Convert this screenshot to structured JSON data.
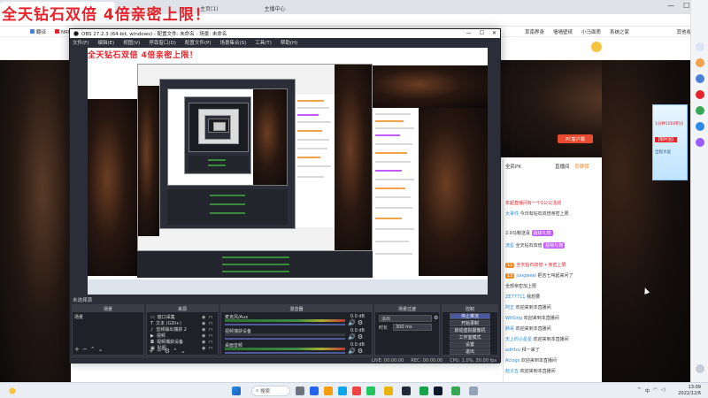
{
  "browser": {
    "tabs": [
      {
        "label": "全天钻石双倍 4倍亲密上限！",
        "active": true
      },
      {
        "label": "主页(1)",
        "active": false
      },
      {
        "label": "主题中心",
        "active": false
      },
      {
        "label": "主播中心",
        "active": false
      }
    ],
    "bookmarks": [
      "翻译",
      "NRU魔兽世界",
      "全天钻石双倍 4倍亲密上限！"
    ],
    "bookmarks_right": [
      "草南界身",
      "墙墙壁纸",
      "小马面质",
      "系统之家",
      "其他收藏夹"
    ],
    "promo": "全天钻石双倍 4倍亲密上限！"
  },
  "stream_page": {
    "pc_button": "PC客户端",
    "chat_tabs": [
      "全民PK",
      "直播间",
      "贡献榜"
    ],
    "chat_lines": [
      {
        "user": "",
        "text": "年起直播间有一个1公公活动",
        "badge": ""
      },
      {
        "user": "大事件",
        "text": "今日有钻石双倍亲密上限",
        "badge": ""
      },
      {
        "user": "",
        "text": "2.0马鞍送喜",
        "badge": "",
        "gift": "超级礼物"
      },
      {
        "user": "流星",
        "text": "全天钻石双倍",
        "badge": "",
        "gift": "超级礼物"
      },
      {
        "user": "",
        "text": "全天钻石双倍 • 亲密上限",
        "badge": "11"
      },
      {
        "user": "jungweel",
        "text": "把吉七叫起来问了",
        "badge": "13"
      },
      {
        "user": "",
        "text": "全部亲密加上限",
        "badge": ""
      },
      {
        "user": "ZE77711",
        "text": "我想要",
        "badge": ""
      },
      {
        "user": "阿正",
        "text": "欢迎来到本直播间",
        "badge": ""
      },
      {
        "user": "WitSing",
        "text": "欢迎来到本直播间",
        "badge": ""
      },
      {
        "user": "胖哥",
        "text": "欢迎来到本直播间",
        "badge": ""
      },
      {
        "user": "天上的小星星",
        "text": "欢迎来到本直播间",
        "badge": ""
      },
      {
        "user": "adhfzu",
        "text": "拜一来了",
        "badge": ""
      },
      {
        "user": "Aclogs",
        "text": "欢迎来到本直播间",
        "badge": ""
      },
      {
        "user": "赵子五",
        "text": "欢迎来到本直播间",
        "badge": ""
      }
    ],
    "side_ad": {
      "line1": "1分钟1000积分",
      "line2": "【限时送】",
      "line3": "全程大促"
    }
  },
  "obs": {
    "title": "OBS 27.2.3 (64-bit, windows) - 配置文件: 未命名 - 场景: 未命名",
    "menu": [
      "文件(F)",
      "编辑(E)",
      "视图(V)",
      "停靠窗口(D)",
      "配置文件(P)",
      "场景集合(S)",
      "工具(T)",
      "帮助(H)"
    ],
    "preview_promo": "全天钻石双倍 4倍亲密上限！",
    "docks": {
      "scene_label": "未选择源",
      "scenes_title": "场景",
      "scenes": [
        "场景"
      ],
      "sources_title": "来源",
      "sources": [
        "窗口采集",
        "文本 (GDI+)",
        "音频输出捕获 2",
        "视频",
        "视频捕获设备",
        "贴图"
      ],
      "mixer_title": "混音器",
      "mixer": [
        {
          "name": "麦克风/Aux",
          "db": "0.0 dB",
          "active": true
        },
        {
          "name": "视频捕获设备",
          "db": "0.0 dB",
          "active": false
        },
        {
          "name": "桌面音频",
          "db": "0.0 dB",
          "active": true
        }
      ],
      "transitions_title": "场景过渡",
      "transition": "淡出",
      "duration_label": "时长",
      "duration": "300 ms",
      "controls_title": "控制",
      "controls": [
        "停止推流",
        "开始录制",
        "启动虚拟摄像机",
        "工作室模式",
        "设置",
        "退出"
      ]
    },
    "status": [
      "LIVE: 00:00:00",
      "REC: 00:00:00",
      "CPU: 1.0%, 30.00 fps"
    ]
  },
  "taskbar": {
    "search": "搜索",
    "time": "13:09",
    "date": "2022/12/6",
    "tray": [
      "^",
      "中"
    ]
  }
}
